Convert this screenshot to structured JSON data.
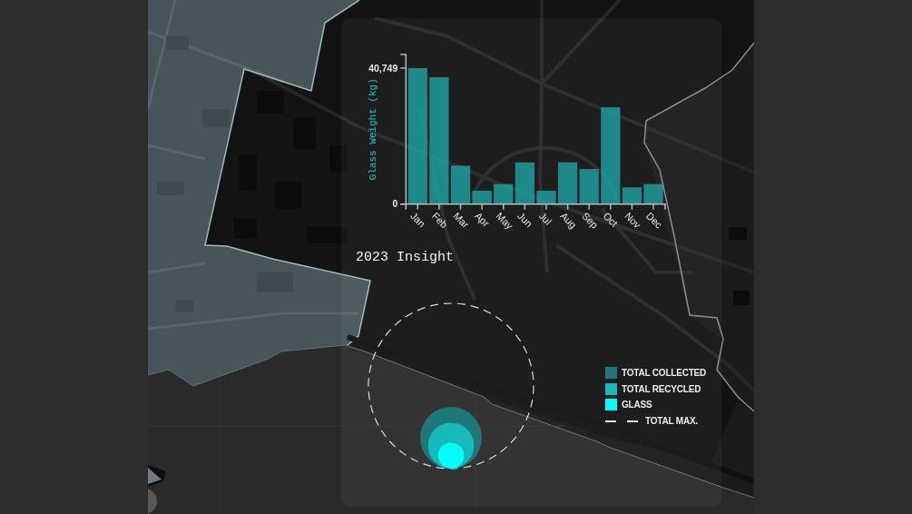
{
  "chart": {
    "chart_data": {
      "type": "bar",
      "ylabel": "Glass Weight (kg)",
      "categories": [
        "Jan",
        "Feb",
        "Mar",
        "Apr",
        "May",
        "Jun",
        "Jul",
        "Aug",
        "Sep",
        "Oct",
        "Nov",
        "Dec"
      ],
      "values": [
        40749,
        38000,
        11500,
        4000,
        6000,
        12500,
        4000,
        12500,
        10500,
        29000,
        5000,
        6000
      ],
      "ylim": [
        0,
        44824
      ],
      "yticks": [
        {
          "value": 0,
          "label": "0"
        },
        {
          "value": 40749,
          "label": "40,749"
        }
      ]
    }
  },
  "insight": {
    "title": "2023 Insight",
    "legend": [
      {
        "kind": "swatch",
        "label": "TOTAL COLLECTED",
        "color": "#1d7878"
      },
      {
        "kind": "swatch",
        "label": "TOTAL RECYCLED",
        "color": "#17b9b9"
      },
      {
        "kind": "swatch",
        "label": "GLASS",
        "color": "#00ffff"
      },
      {
        "kind": "dashed",
        "label": "TOTAL MAX."
      }
    ]
  }
}
